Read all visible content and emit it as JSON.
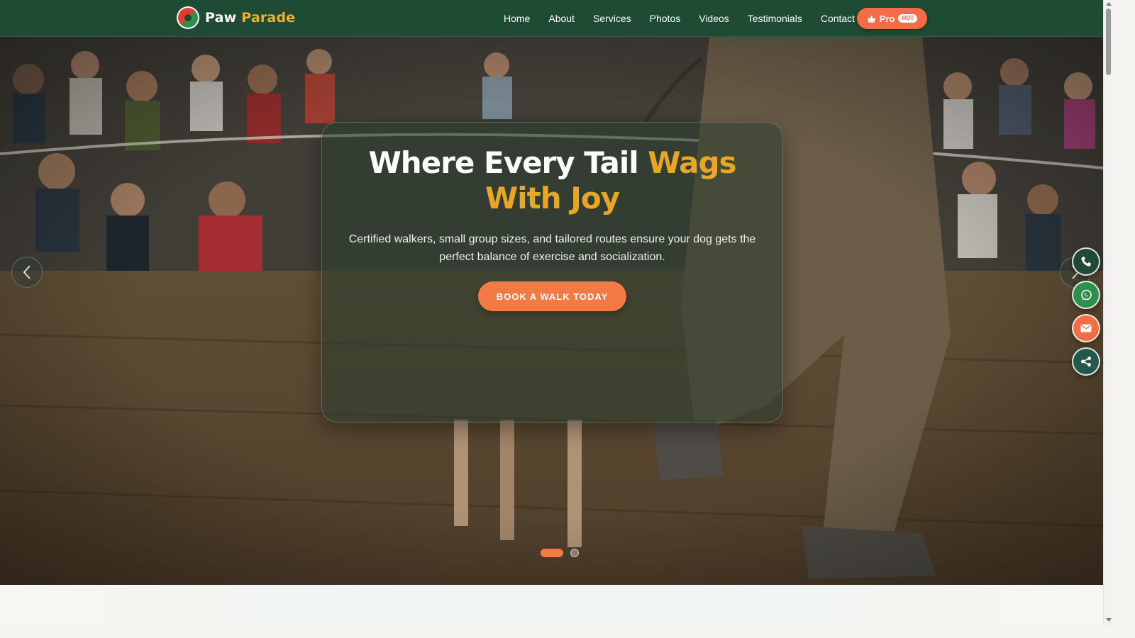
{
  "brand": {
    "name_part1": "Paw",
    "name_part2": "Parade",
    "logo_icon": "paw-parade-logo-icon"
  },
  "nav": {
    "links": [
      "Home",
      "About",
      "Services",
      "Photos",
      "Videos",
      "Testimonials",
      "Contact"
    ],
    "pro_label": "Pro",
    "pro_badge": "HOT",
    "pro_icon": "crown-icon"
  },
  "hero": {
    "title_white": "Where Every Tail",
    "title_highlight": "Wags With Joy",
    "subtitle": "Certified walkers, small group sizes, and tailored routes ensure your dog gets the perfect balance of exercise and socialization.",
    "cta_label": "BOOK A WALK TODAY",
    "slide_count": 2,
    "active_slide": 1
  },
  "floating_actions": [
    "phone-icon",
    "whatsapp-icon",
    "email-icon",
    "share-icon"
  ],
  "colors": {
    "nav_bg": "#1f4a33",
    "accent_orange": "#f47a45",
    "accent_gold": "#e8a624",
    "whatsapp_green": "#2f8f4e"
  }
}
